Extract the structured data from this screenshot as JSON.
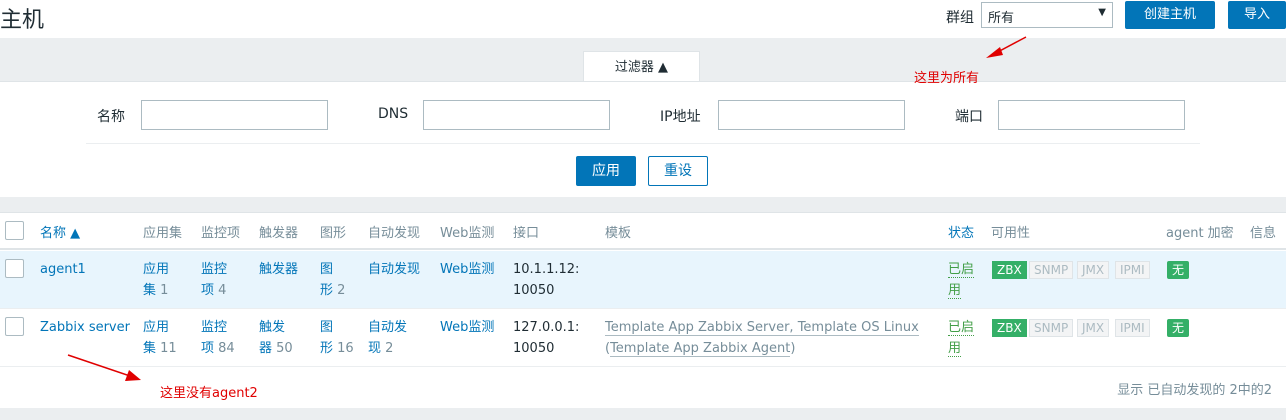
{
  "header": {
    "title": "主机",
    "group_label": "群组",
    "group_value": "所有",
    "create_button": "创建主机",
    "import_button": "导入"
  },
  "filter": {
    "tab_label": "过滤器 ▲",
    "name_label": "名称",
    "dns_label": "DNS",
    "ip_label": "IP地址",
    "port_label": "端口",
    "apply_button": "应用",
    "reset_button": "重设"
  },
  "table": {
    "columns": {
      "name": "名称 ▲",
      "applications": "应用集",
      "items": "监控项",
      "triggers": "触发器",
      "graphs": "图形",
      "discovery": "自动发现",
      "web": "Web监测",
      "interface": "接口",
      "templates": "模板",
      "status": "状态",
      "availability": "可用性",
      "encryption": "agent 加密",
      "info": "信息"
    },
    "rows": [
      {
        "name": "agent1",
        "app_line1": "应用",
        "app_line2": "集",
        "app_count": "1",
        "items_line1": "监控",
        "items_line2": "项",
        "items_count": "4",
        "triggers_line1": "触发器",
        "triggers_line2": "",
        "triggers_count": "",
        "graphs_line1": "图",
        "graphs_line2": "形",
        "graphs_count": "2",
        "discovery_line1": "自动发现",
        "discovery_line2": "",
        "discovery_count": "",
        "web": "Web监测",
        "iface_line1": "10.1.1.12:",
        "iface_line2": "10050",
        "templates_line1": "",
        "templates_line2": "",
        "status_line1": "已启",
        "status_line2": "用",
        "zbx": "ZBX",
        "snmp": "SNMP",
        "jmx": "JMX",
        "ipmi": "IPMI",
        "encryption": "无"
      },
      {
        "name": "Zabbix server",
        "app_line1": "应用",
        "app_line2": "集",
        "app_count": "11",
        "items_line1": "监控",
        "items_line2": "项",
        "items_count": "84",
        "triggers_line1": "触发",
        "triggers_line2": "器",
        "triggers_count": "50",
        "graphs_line1": "图",
        "graphs_line2": "形",
        "graphs_count": "16",
        "discovery_line1": "自动发",
        "discovery_line2": "现",
        "discovery_count": "2",
        "web": "Web监测",
        "iface_line1": "127.0.0.1:",
        "iface_line2": "10050",
        "templates_line1": "Template App Zabbix Server, Template OS Linux",
        "templates_open": "(",
        "templates_line2": "Template App Zabbix Agent",
        "templates_close": ")",
        "status_line1": "已启",
        "status_line2": "用",
        "zbx": "ZBX",
        "snmp": "SNMP",
        "jmx": "JMX",
        "ipmi": "IPMI",
        "encryption": "无"
      }
    ],
    "footer": "显示 已自动发现的 2中的2"
  },
  "annotations": {
    "note_all": "这里为所有",
    "note_no_agent2": "这里没有agent2"
  }
}
